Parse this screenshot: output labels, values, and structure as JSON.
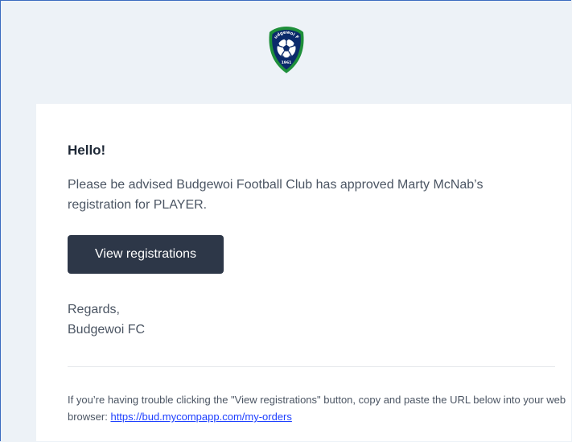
{
  "header": {
    "logo_icon": "budgewoi-fc-crest-icon",
    "logo_arc_text": "Budgewoi FC",
    "logo_year": "1961",
    "logo_colors": {
      "ring": "#1e8f3a",
      "shield": "#0b2a6b",
      "ball": "#ffffff"
    }
  },
  "email": {
    "greeting": "Hello!",
    "message": "Please be advised Budgewoi Football Club has approved Marty McNab’s registration for PLAYER.",
    "action_button_label": "View registrations",
    "regards_line1": "Regards,",
    "regards_line2": "Budgewoi FC",
    "subcopy_text": "If you’re having trouble clicking the \"View registrations\" button, copy and paste the URL below into your web browser: ",
    "subcopy_link": "https://bud.mycompapp.com/my-orders"
  },
  "colors": {
    "page_background": "#edf2f7",
    "card_background": "#ffffff",
    "button_background": "#2d3748",
    "link": "#1e40ff"
  }
}
